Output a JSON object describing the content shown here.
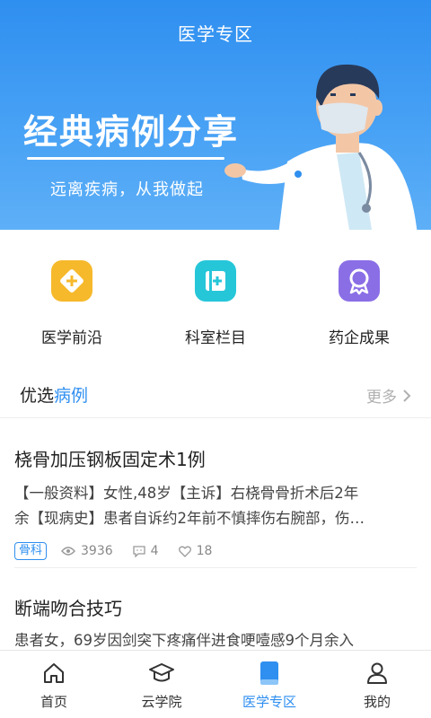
{
  "header": {
    "title": "医学专区"
  },
  "banner": {
    "headline": "经典病例分享",
    "subtitle": "远离疾病，从我做起"
  },
  "quick_entries": [
    {
      "label": "医学前沿",
      "icon": "plus-diamond-icon",
      "color": "#f6b92b"
    },
    {
      "label": "科室栏目",
      "icon": "medical-book-icon",
      "color": "#26c6d9"
    },
    {
      "label": "药企成果",
      "icon": "award-ribbon-icon",
      "color": "#8a6ee6"
    }
  ],
  "section": {
    "title_prefix": "优选",
    "title_highlight": "病例",
    "more_label": "更多"
  },
  "cases": [
    {
      "title": "桡骨加压钢板固定术1例",
      "excerpt_line1": "【一般资料】女性,48岁【主诉】右桡骨骨折术后2年",
      "excerpt_line2": "余【现病史】患者自诉约2年前不慎摔伤右腕部，伤…",
      "tag": "骨科",
      "views": "3936",
      "comments": "4",
      "likes": "18"
    },
    {
      "title": "断端吻合技巧",
      "excerpt_line1": "患者女，69岁因剑突下疼痛伴进食哽噎感9个月余入"
    }
  ],
  "tabbar": {
    "items": [
      {
        "label": "首页",
        "icon": "home-icon"
      },
      {
        "label": "云学院",
        "icon": "graduation-cap-icon"
      },
      {
        "label": "医学专区",
        "icon": "book-icon",
        "active": true
      },
      {
        "label": "我的",
        "icon": "user-icon"
      }
    ]
  },
  "colors": {
    "primary": "#2f8ff0",
    "banner": "#4aa3f5"
  }
}
